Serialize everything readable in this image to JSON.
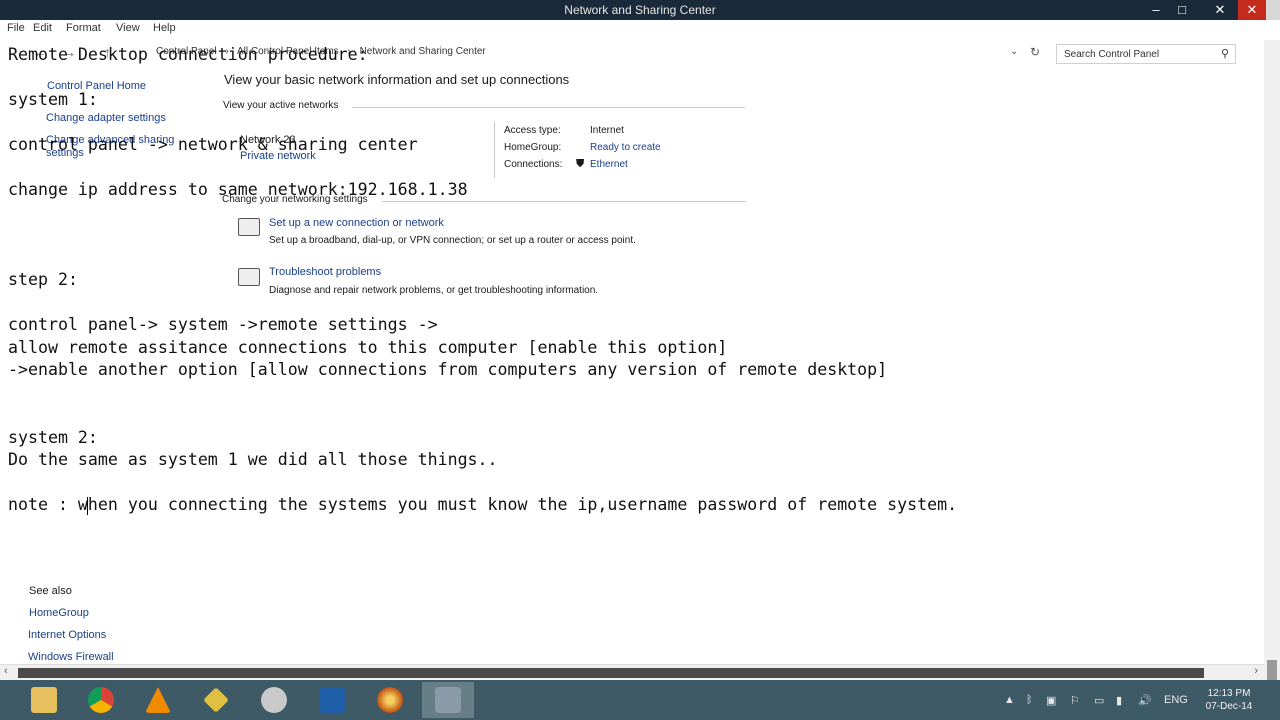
{
  "window": {
    "title": "Network and Sharing Center",
    "buttons": {
      "minimize": "–",
      "maximize": "□",
      "close": "✕",
      "close_inner": "✕"
    }
  },
  "menu": [
    "File",
    "Edit",
    "Format",
    "View",
    "Help"
  ],
  "address": {
    "crumbs": [
      "Control Panel",
      "›",
      "All Control Panel Items",
      "›",
      "Network and Sharing Center"
    ],
    "search_placeholder": "Search Control Panel",
    "nav": {
      "back": "←",
      "forward": "→",
      "up": "↑",
      "dropdown": "⌄",
      "refresh": "↻"
    }
  },
  "control_panel": {
    "sidebar": {
      "home": "Control Panel Home",
      "adapter": "Change adapter settings",
      "sharing_1": "Change advanced sharing",
      "sharing_2": "settings"
    },
    "heading": "View your basic network information and set up connections",
    "active_networks": "View your active networks",
    "network_name": "Network 23",
    "network_type": "Private network",
    "access_type_label": "Access type:",
    "access_type_value": "Internet",
    "homegroup_label": "HomeGroup:",
    "homegroup_value": "Ready to create",
    "connections_label": "Connections:",
    "connections_value": "Ethernet",
    "change_settings": "Change your networking settings",
    "setup_title": "Set up a new connection or network",
    "setup_desc": "Set up a broadband, dial-up, or VPN connection; or set up a router or access point.",
    "trouble_title": "Troubleshoot problems",
    "trouble_desc": "Diagnose and repair network problems, or get troubleshooting information.",
    "see_also": "See also",
    "see_homegroup": "HomeGroup",
    "see_internet": "Internet Options",
    "see_firewall": "Windows Firewall"
  },
  "notepad": {
    "line1": "Remote Desktop connection procedure:",
    "line2": "system 1:",
    "line3": "control panel -> network & sharing center",
    "line4": "change ip address to same network:192.168.1.38",
    "line5": "step 2:",
    "line6": "control panel-> system ->remote settings ->",
    "line7": "allow remote assitance connections to this computer [enable this option]",
    "line8": "->enable another option [allow connections from computers any version of remote desktop]",
    "line9": "system 2:",
    "line10": "Do the same as system 1 we did all those things..",
    "line11": "note : when you connecting the systems you must know the ip,username password of remote system."
  },
  "taskbar": {
    "apps": [
      "file-explorer",
      "chrome",
      "vlc",
      "pencil-tool",
      "network-tool",
      "wifi-tool",
      "media-disc",
      "notepad"
    ],
    "tray": {
      "expand": "▲",
      "bluetooth": "ᛒ",
      "language": "ENG",
      "volume": "🔊"
    },
    "time": "12:13 PM",
    "date": "07-Dec-14"
  },
  "colors": {
    "taskbar": "#3e5a66",
    "titlebar": "#1b2a3a",
    "close": "#c42b1c",
    "link": "#1a3f8a"
  }
}
